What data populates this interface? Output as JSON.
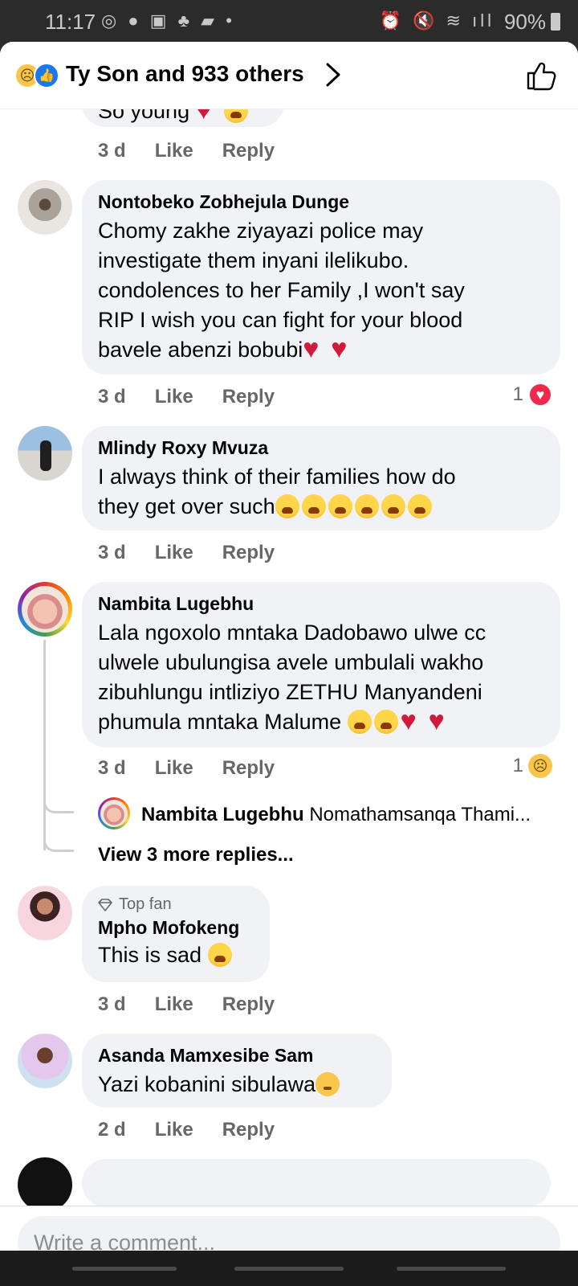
{
  "status_bar": {
    "time": "11:17",
    "left_icons": "◎ ● ▣ ♣ ▰ •",
    "right_icons": "⏰ 🔇 ≋ ıll",
    "battery": "90%"
  },
  "header": {
    "reaction_icons": [
      "sad-reaction-icon",
      "like-reaction-icon"
    ],
    "title": "Ty Son and 933 others"
  },
  "top_partial_comment": {
    "text": "So young",
    "meta": {
      "time": "3 d",
      "like": "Like",
      "reply": "Reply"
    }
  },
  "comments": [
    {
      "name": "Nontobeko Zobhejula Dunge",
      "lines": [
        "Chomy zakhe ziyayazi police may",
        "investigate them inyani ilelikubo.",
        "condolences to her Family ,I won't say",
        "RIP I wish you can fight for your blood",
        "bavele abenzi bobubi"
      ],
      "meta": {
        "time": "3 d",
        "like": "Like",
        "reply": "Reply"
      },
      "reaction_count": "1"
    },
    {
      "name": "Mlindy Roxy Mvuza",
      "lines": [
        "I always think of their families how do",
        "they get over such"
      ],
      "meta": {
        "time": "3 d",
        "like": "Like",
        "reply": "Reply"
      }
    },
    {
      "name": "Nambita Lugebhu",
      "lines": [
        "Lala ngoxolo mntaka Dadobawo ulwe cc",
        "ulwele ubulungisa avele umbulali wakho",
        "zibuhlungu intliziyo ZETHU Manyandeni",
        "phumula mntaka Malume"
      ],
      "meta": {
        "time": "3 d",
        "like": "Like",
        "reply": "Reply"
      },
      "reaction_count": "1",
      "reply_preview": {
        "name": "Nambita Lugebhu",
        "text": "Nomathamsanqa Thami..."
      },
      "view_more": "View 3 more replies..."
    },
    {
      "badge": "Top fan",
      "name": "Mpho Mofokeng",
      "lines": [
        "This is sad"
      ],
      "meta": {
        "time": "3 d",
        "like": "Like",
        "reply": "Reply"
      }
    },
    {
      "name": "Asanda Mamxesibe Sam",
      "lines": [
        "Yazi kobanini sibulawa"
      ],
      "meta": {
        "time": "2 d",
        "like": "Like",
        "reply": "Reply"
      }
    }
  ],
  "composer": {
    "placeholder": "Write a comment..."
  },
  "colors": {
    "bubble": "#f0f2f5",
    "meta_text": "#65676b",
    "like_blue": "#1877f2",
    "love_red": "#f02849",
    "sad_yellow": "#f7c64a"
  }
}
